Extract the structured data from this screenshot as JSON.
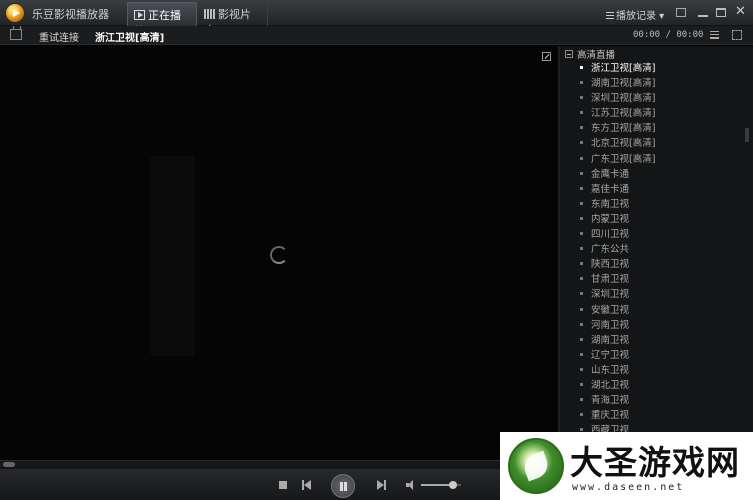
{
  "app": {
    "title": "乐豆影视播放器",
    "tabs": [
      {
        "label": "正在播放",
        "active": true
      },
      {
        "label": "影视片库",
        "active": false
      }
    ],
    "history_label": "播放记录"
  },
  "toolbar": {
    "retry_label": "重试连接",
    "current_channel": "浙江卫视[高清]",
    "time_display": "00:00 / 00:00"
  },
  "sidebar": {
    "group_title": "高清直播",
    "channels": [
      "浙江卫视[高清]",
      "湖南卫视[高清]",
      "深圳卫视[高清]",
      "江苏卫视[高清]",
      "东方卫视[高清]",
      "北京卫视[高清]",
      "广东卫视[高清]",
      "金鹰卡通",
      "嘉佳卡通",
      "东南卫视",
      "内蒙卫视",
      "四川卫视",
      "广东公共",
      "陕西卫视",
      "甘肃卫视",
      "深圳卫视",
      "安徽卫视",
      "河南卫视",
      "湖南卫视",
      "辽宁卫视",
      "山东卫视",
      "湖北卫视",
      "青海卫视",
      "重庆卫视",
      "西藏卫视"
    ],
    "active_index": 0
  },
  "player": {
    "state": "loading",
    "volume": 0.8
  },
  "watermark": {
    "name": "大圣游戏网",
    "url": "www.daseen.net"
  },
  "colors": {
    "background": "#000000",
    "titlebar": "#2b2e32",
    "sidebar": "#141516",
    "active_text": "#ffffff",
    "inactive_text": "#a7a7a7",
    "watermark_green": "#3f8d2a"
  }
}
